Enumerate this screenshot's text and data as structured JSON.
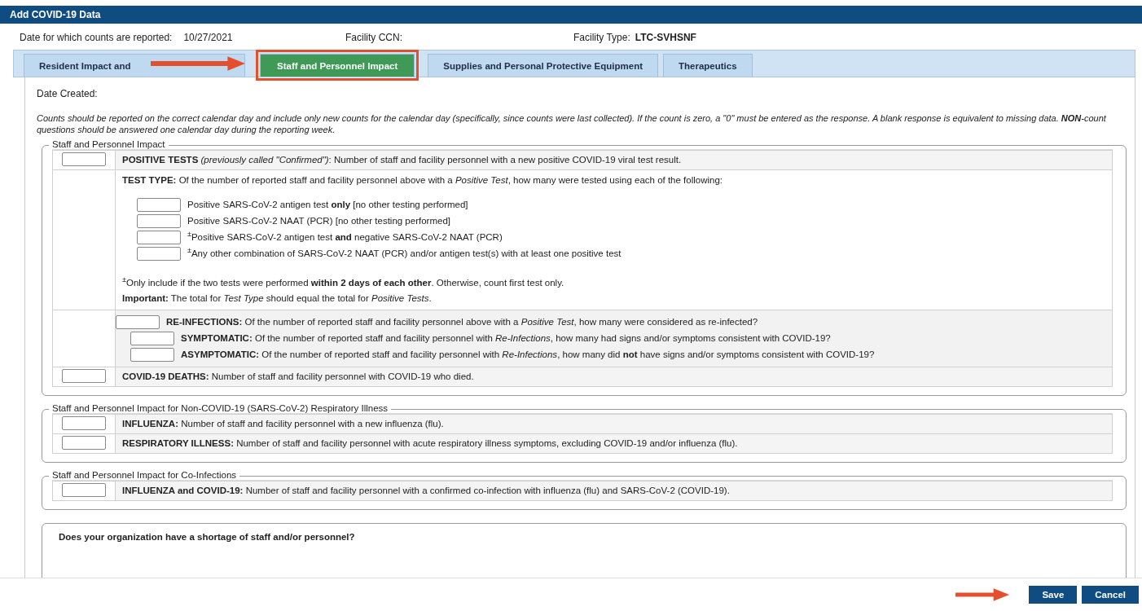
{
  "window": {
    "title": "Add COVID-19 Data"
  },
  "info": [
    {
      "label": "Date for which counts are reported:",
      "value": "10/27/2021"
    },
    {
      "label": "Facility CCN:"
    },
    {
      "label": "Facility Type:",
      "value": "LTC-SVHSNF"
    }
  ],
  "tabs": [
    {
      "label": "Resident Impact and",
      "selected": false
    },
    {
      "label": "Staff and Personnel Impact",
      "selected": true
    },
    {
      "label": "Supplies and Personal Protective Equipment",
      "selected": false
    },
    {
      "label": "Therapeutics",
      "selected": false
    }
  ],
  "date_created": {
    "label": "Date Created:"
  },
  "instructions": "Counts should be reported on the correct calendar day and include only new counts for the calendar day (specifically, since counts were last collected). If the count is zero, a \"0\" must be entered as the response. A blank response is equivalent to missing data. **NON**-count questions should be answered one calendar day during the reporting week.",
  "sections": [
    {
      "legend": "Staff and Personnel Impact",
      "rows": [
        {
          "kind": "question",
          "text": "**POSITIVE TESTS** *(previously called \"Confirmed\")*: Number of staff and facility personnel with a new positive COVID-19 viral test result."
        },
        {
          "kind": "group",
          "intro": "**TEST TYPE:** Of the number of reported staff and facility personnel above with a *Positive Test*, how many were tested using each of the following:",
          "items": [
            "Positive SARS-CoV-2 antigen test **only** [no other testing performed]",
            "Positive SARS-CoV-2 NAAT (PCR) [no other testing performed]",
            "$^{±}$Positive SARS-CoV-2 antigen test **and** negative SARS-CoV-2 NAAT (PCR)",
            "$^{±}$Any other combination of SARS-CoV-2 NAAT (PCR) and/or antigen test(s) with at least one positive test"
          ],
          "notes": [
            "$^{±}$Only include if the two tests were performed **within 2 days of each other**. Otherwise, count first test only.",
            "**Important:** The total for *Test Type* should equal the total for *Positive Tests*."
          ]
        },
        {
          "kind": "nested",
          "text": "**RE-INFECTIONS:** Of the number of reported staff and facility personnel above with a *Positive Test*, how many were considered as re-infected?",
          "children": [
            "**SYMPTOMATIC:** Of the number of reported staff and facility personnel with *Re-Infections*, how many had signs and/or symptoms consistent with COVID-19?",
            "**ASYMPTOMATIC:** Of the number of reported staff and facility personnel with *Re-Infections*, how many did **not** have signs and/or symptoms consistent with COVID-19?"
          ]
        },
        {
          "kind": "question",
          "text": "**COVID-19 DEATHS:** Number of staff and facility personnel with COVID-19 who died."
        }
      ]
    },
    {
      "legend": "Staff and Personnel Impact for Non-COVID-19 (SARS-CoV-2) Respiratory Illness",
      "rows": [
        {
          "kind": "question",
          "text": "**INFLUENZA:** Number of staff and facility personnel with a new influenza (flu)."
        },
        {
          "kind": "question",
          "text": "**RESPIRATORY ILLNESS:** Number of staff and facility personnel with acute respiratory illness symptoms, excluding COVID-19 and/or influenza (flu)."
        }
      ]
    },
    {
      "legend": "Staff and Personnel Impact for Co-Infections",
      "rows": [
        {
          "kind": "question",
          "text": "**INFLUENZA and COVID-19:** Number of staff and facility personnel with a confirmed co-infection with influenza (flu) and SARS-CoV-2 (COVID-19)."
        }
      ]
    },
    {
      "rows": [
        {
          "kind": "prompt",
          "text": "Does your organization have a shortage of staff and/or personnel?"
        }
      ]
    }
  ],
  "buttons": [
    {
      "label": "Save"
    },
    {
      "label": "Cancel"
    }
  ]
}
